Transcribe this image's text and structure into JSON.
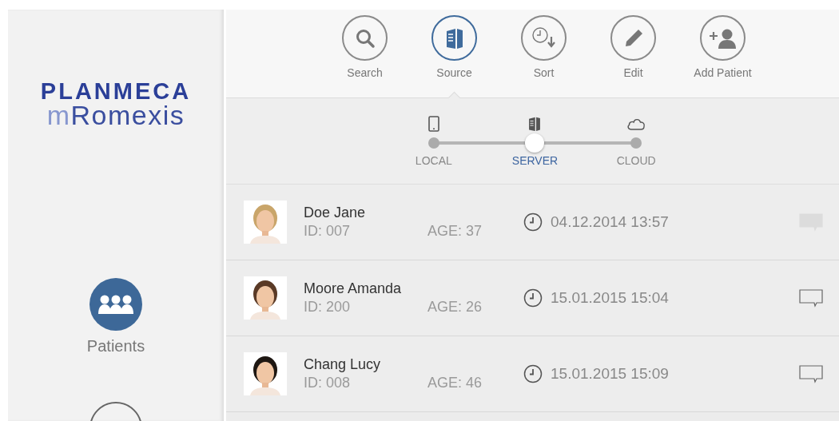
{
  "logo": {
    "brand": "PLANMECA",
    "product_prefix": "m",
    "product": "Romexis"
  },
  "sidebar": {
    "items": [
      {
        "label": "Patients",
        "kind": "patients",
        "selected": true
      },
      {
        "kind": "other",
        "selected": false
      }
    ]
  },
  "toolbar": [
    {
      "label": "Search",
      "kind": "search",
      "selected": false
    },
    {
      "label": "Source",
      "kind": "server",
      "selected": true
    },
    {
      "label": "Sort",
      "kind": "sort",
      "selected": false
    },
    {
      "label": "Edit",
      "kind": "edit",
      "selected": false
    },
    {
      "label": "Add Patient",
      "kind": "add",
      "selected": false
    }
  ],
  "sources": [
    {
      "label": "LOCAL",
      "kind": "tablet",
      "selected": false
    },
    {
      "label": "SERVER",
      "kind": "server",
      "selected": true
    },
    {
      "label": "CLOUD",
      "kind": "cloud",
      "selected": false
    }
  ],
  "patients": [
    {
      "name": "Doe Jane",
      "id": "ID: 007",
      "age": "AGE: 37",
      "date": "04.12.2014 13:57",
      "comment_filled": true
    },
    {
      "name": "Moore Amanda",
      "id": "ID: 200",
      "age": "AGE: 26",
      "date": "15.01.2015 15:04",
      "comment_filled": false
    },
    {
      "name": "Chang Lucy",
      "id": "ID: 008",
      "age": "AGE: 46",
      "date": "15.01.2015 15:09",
      "comment_filled": false
    }
  ]
}
